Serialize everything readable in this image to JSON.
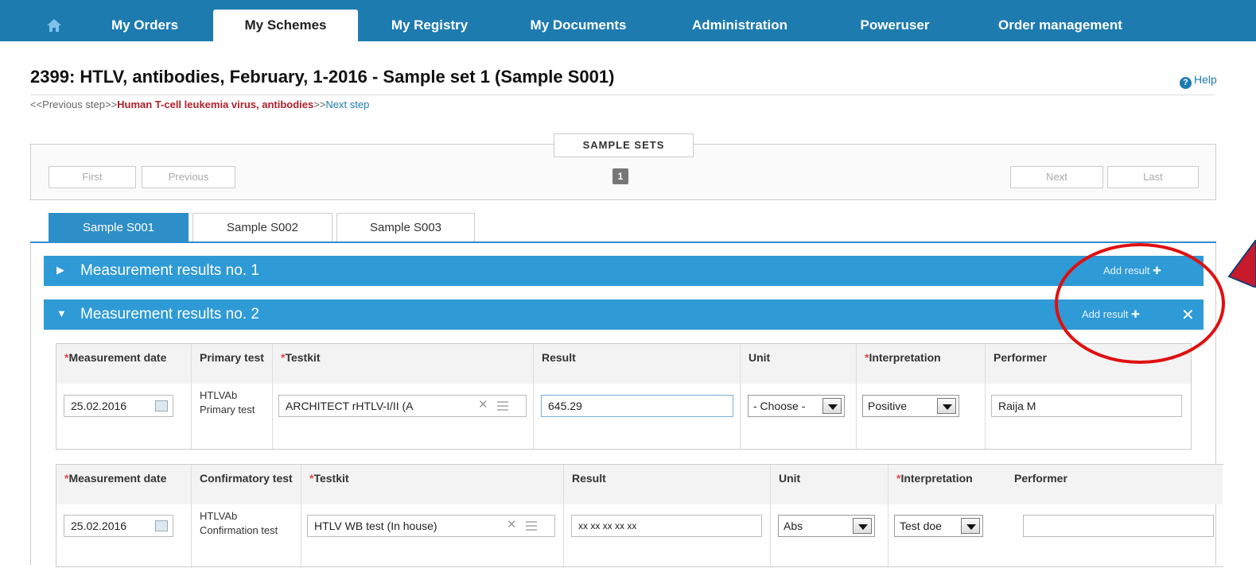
{
  "nav": {
    "home_icon": "home-icon",
    "tabs": [
      "My Orders",
      "My Schemes",
      "My Registry",
      "My Documents",
      "Administration",
      "Poweruser",
      "Order management"
    ],
    "active_tab": "My Schemes"
  },
  "page": {
    "title": "2399: HTLV, antibodies, February, 1-2016 - Sample set 1 (Sample S001)",
    "help": "Help"
  },
  "breadcrumb": {
    "prev": "<<Previous step>>",
    "current": "Human T-cell leukemia virus, antibodies",
    "sep": ">>",
    "next": "Next step"
  },
  "sample_sets": {
    "title": "SAMPLE SETS",
    "first": "First",
    "previous": "Previous",
    "page": "1",
    "next": "Next",
    "last": "Last"
  },
  "sample_tabs": [
    "Sample S001",
    "Sample S002",
    "Sample S003"
  ],
  "measurements": [
    {
      "title": "Measurement results no. 1",
      "add": "Add result",
      "collapsed": true
    },
    {
      "title": "Measurement results no. 2",
      "add": "Add result",
      "collapsed": false
    }
  ],
  "table1": {
    "headers": {
      "date": "Measurement date",
      "test": "Primary test",
      "testkit": "Testkit",
      "result": "Result",
      "unit": "Unit",
      "interpretation": "Interpretation",
      "performer": "Performer"
    },
    "row": {
      "date": "25.02.2016",
      "test": "HTLVAb Primary test",
      "testkit": "ARCHITECT rHTLV-I/II (A",
      "result": "645.29",
      "unit": "- Choose -",
      "interpretation": "Positive",
      "performer": "Raija M"
    }
  },
  "table2": {
    "headers": {
      "date": "Measurement date",
      "test": "Confirmatory test",
      "testkit": "Testkit",
      "result": "Result",
      "unit": "Unit",
      "interpretation": "Interpretation",
      "performer": "Performer"
    },
    "row": {
      "date": "25.02.2016",
      "test": "HTLVAb Confirmation test",
      "testkit": "HTLV WB test (In house)",
      "result": "xx xx xx xx xx",
      "unit": "Abs",
      "interpretation": "Test doe",
      "performer": ""
    }
  },
  "required_mark": "*",
  "colors": {
    "brand": "#1d7bb0",
    "bar": "#2e9ad6",
    "annotation": "#e01010"
  }
}
